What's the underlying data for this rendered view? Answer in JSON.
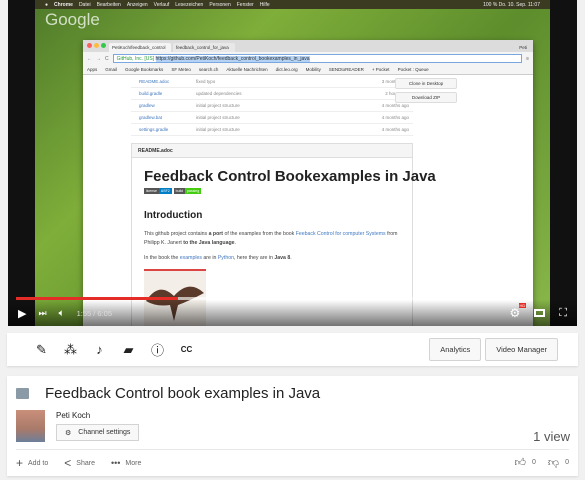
{
  "player": {
    "menubar": {
      "items": [
        "Chrome",
        "Datei",
        "Bearbeiten",
        "Anzeigen",
        "Verlauf",
        "Lesezeichen",
        "Personen",
        "Fenster",
        "Hilfe"
      ],
      "status": "100 % Do. 10. Sep. 11:07"
    },
    "wallpaper_logo": "Google",
    "browser": {
      "tabs": [
        "PetiKoch/feedback_control",
        "feedback_control_for_java"
      ],
      "user": "Peti",
      "url_secure": "GitHub, Inc. [US]",
      "url": "https://github.com/PetiKoch/feedback_control_bookexamples_in_java",
      "bookmarks": [
        "Apps",
        "Gmail",
        "Google Bookmarks",
        "SF Meteo",
        "search.ch",
        "Aktuelle Nachrichten",
        "dict.leo.org",
        "Mobility",
        "SENDtoREADER",
        "+ Pocket",
        "Pocket : Queue"
      ],
      "files": [
        {
          "name": "README.adoc",
          "msg": "fixed typo",
          "time": "3 months ago"
        },
        {
          "name": "build.gradle",
          "msg": "updated dependencies",
          "time": "2 hours ago"
        },
        {
          "name": "gradlew",
          "msg": "initial project structure",
          "time": "4 months ago"
        },
        {
          "name": "gradlew.bat",
          "msg": "initial project structure",
          "time": "4 months ago"
        },
        {
          "name": "settings.gradle",
          "msg": "initial project structure",
          "time": "4 months ago"
        }
      ],
      "side_buttons": [
        "Clone in Desktop",
        "Download ZIP"
      ],
      "readme": {
        "header": "README.adoc",
        "title": "Feedback Control Bookexamples in Java",
        "badges": [
          {
            "k": "license",
            "v": "ASF2",
            "color": "#007ec6"
          },
          {
            "k": "build",
            "v": "passing",
            "color": "#4c1"
          }
        ],
        "intro": "Introduction",
        "p1a": "This github project contains ",
        "p1b": "a port",
        "p1c": " of the examples from the book ",
        "p1link": "Feeback Control for computer Systems",
        "p1d": " from Philipp K. Janert ",
        "p1e": "to the Java language",
        "p2a": "In the book the ",
        "p2link1": "examples",
        "p2b": " are in ",
        "p2link2": "Python",
        "p2c": ", here they are in ",
        "p2d": "Java 8"
      }
    },
    "time": "1:55 / 6:05",
    "progress": 0.315,
    "buffered": 0.75,
    "hd_badge": "HD"
  },
  "toolbar": {
    "icons": [
      "pencil-icon",
      "magic-wand-icon",
      "music-note-icon",
      "annotation-icon",
      "info-icon",
      "cc-icon"
    ],
    "analytics": "Analytics",
    "video_manager": "Video Manager"
  },
  "info": {
    "title": "Feedback Control book examples in Java",
    "channel": "Peti Koch",
    "channel_settings": "Channel settings",
    "views": "1 view",
    "add_to": "Add to",
    "share": "Share",
    "more": "More",
    "likes": "0",
    "dislikes": "0"
  },
  "colors": {
    "progress": "#e52d27"
  }
}
